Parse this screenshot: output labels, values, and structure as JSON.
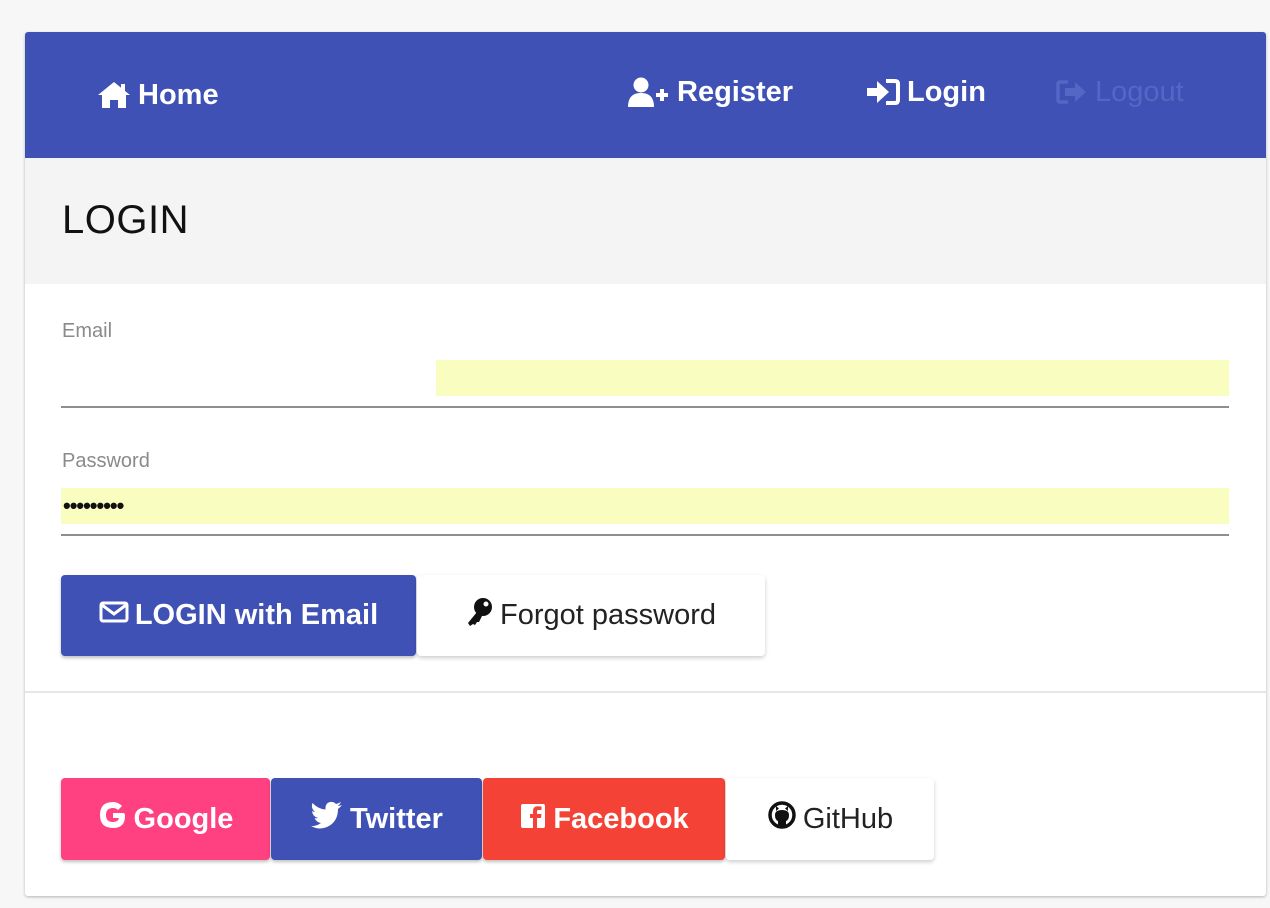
{
  "colors": {
    "primary": "#3f51b5",
    "accent_pink": "#ff4081",
    "facebook_red": "#f44336",
    "autofill_yellow": "#fafdc0",
    "logout_disabled": "#5566c4"
  },
  "navbar": {
    "home": {
      "label": "Home",
      "icon": "home-icon"
    },
    "register": {
      "label": "Register",
      "icon": "user-plus-icon"
    },
    "login": {
      "label": "Login",
      "icon": "sign-in-icon"
    },
    "logout": {
      "label": "Logout",
      "icon": "sign-out-icon",
      "disabled": true
    }
  },
  "page": {
    "title": "LOGIN"
  },
  "form": {
    "email": {
      "label": "Email",
      "value": ""
    },
    "password": {
      "label": "Password",
      "value_masked": "•••••••••"
    }
  },
  "actions": {
    "login_email": {
      "label": "LOGIN with Email",
      "icon": "envelope-icon"
    },
    "forgot_password": {
      "label": "Forgot password",
      "icon": "key-icon"
    }
  },
  "social": {
    "google": {
      "label": "Google",
      "icon": "google-icon"
    },
    "twitter": {
      "label": "Twitter",
      "icon": "twitter-icon"
    },
    "facebook": {
      "label": "Facebook",
      "icon": "facebook-icon"
    },
    "github": {
      "label": "GitHub",
      "icon": "github-icon"
    }
  }
}
